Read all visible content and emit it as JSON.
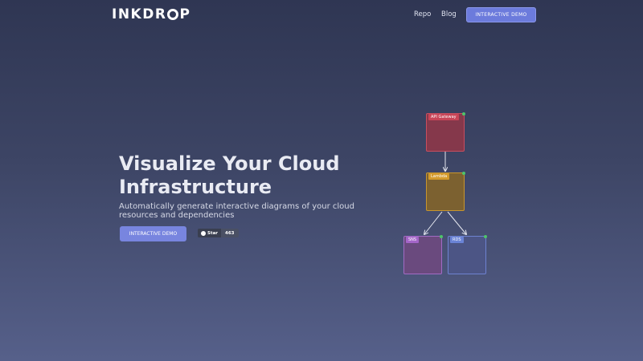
{
  "header": {
    "logo_text_left": "INKDR",
    "logo_text_right": "P",
    "nav": [
      {
        "label": "Repo"
      },
      {
        "label": "Blog"
      }
    ],
    "cta_label": "INTERACTIVE DEMO"
  },
  "hero": {
    "title": "Visualize Your Cloud Infrastructure",
    "subtitle": "Automatically generate interactive diagrams of your cloud resources and dependencies",
    "cta_label": "INTERACTIVE DEMO",
    "github": {
      "label": "Star",
      "count": "463"
    }
  },
  "diagram": {
    "nodes": [
      {
        "id": "api",
        "label": "API Gateway",
        "color": "#c84457"
      },
      {
        "id": "lambda",
        "label": "Lambda",
        "color": "#d39a2c"
      },
      {
        "id": "sns",
        "label": "SNS",
        "color": "#a465c8"
      },
      {
        "id": "rds",
        "label": "RDS",
        "color": "#6a83d6"
      }
    ]
  },
  "colors": {
    "accent": "#6c7bdc",
    "background_top": "#2f3653",
    "background_bottom": "#56608a"
  }
}
